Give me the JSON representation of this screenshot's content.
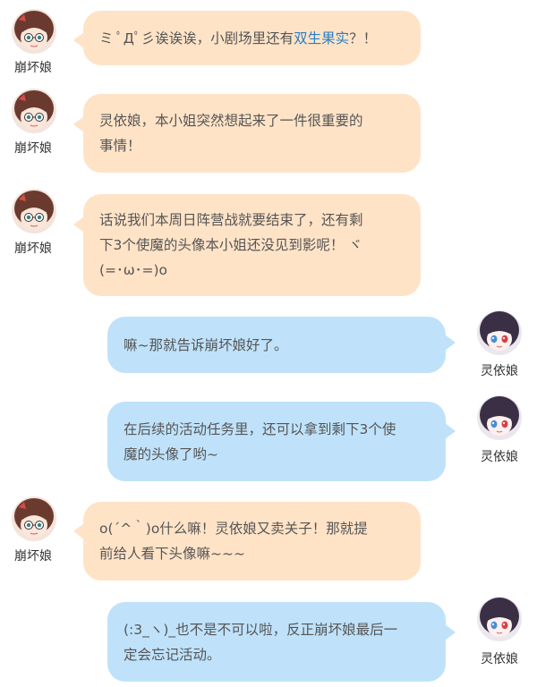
{
  "speakers": {
    "left": {
      "name": "崩坏娘",
      "avatar_icon": "bronya-chibi-avatar-icon",
      "bubble_color": "#ffe3c7"
    },
    "right": {
      "name": "灵依娘",
      "avatar_icon": "lingyi-chibi-avatar-icon",
      "bubble_color": "#bfe2fa"
    }
  },
  "messages": [
    {
      "side": "left",
      "speaker": "崩坏娘",
      "text_before": "ミ ﾟДﾟ彡诶诶诶，小剧场里还有",
      "highlight": "双生果实",
      "text_after": "？！"
    },
    {
      "side": "left",
      "speaker": "崩坏娘",
      "line1": "灵依娘，本小姐突然想起来了一件很重要的",
      "line2": "事情！"
    },
    {
      "side": "left",
      "speaker": "崩坏娘",
      "line1": "话说我们本周日阵营战就要结束了，还有剩",
      "line2": "下3个使魔的头像本小姐还没见到影呢！ ヾ",
      "line3": "(=･ω･=)o"
    },
    {
      "side": "right",
      "speaker": "灵依娘",
      "line1": "嘛~那就告诉崩坏娘好了。"
    },
    {
      "side": "right",
      "speaker": "灵依娘",
      "line1": "在后续的活动任务里，还可以拿到剩下3个使",
      "line2": "魔的头像了哟~"
    },
    {
      "side": "left",
      "speaker": "崩坏娘",
      "line1": "o(´^｀)o什么嘛！灵依娘又卖关子！那就提",
      "line2": "前给人看下头像嘛~~~"
    },
    {
      "side": "right",
      "speaker": "灵依娘",
      "line1": "(:3_ヽ)_也不是不可以啦，反正崩坏娘最后一",
      "line2": "定会忘记活动。"
    }
  ]
}
